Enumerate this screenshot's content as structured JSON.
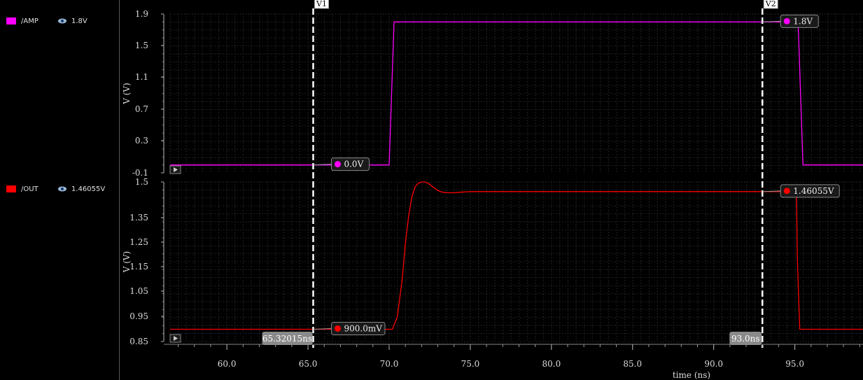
{
  "legend": {
    "traces": [
      {
        "name": "/AMP",
        "value": "1.8V",
        "color": "#ff00ff"
      },
      {
        "name": "/OUT",
        "value": "1.46055V",
        "color": "#ff0000"
      }
    ]
  },
  "chart_data": [
    {
      "type": "line",
      "name": "/AMP",
      "ylabel": "V (V)",
      "xlabel": "time (ns)",
      "yticks": [
        "1.9",
        "1.5",
        "1.1",
        "0.7",
        "0.3",
        "-0.1"
      ],
      "ylim": [
        -0.1,
        1.9
      ],
      "xlim": [
        56.5,
        99.2
      ],
      "color": "#ff00ff",
      "series": [
        {
          "name": "/AMP",
          "x": [
            56.5,
            70.0,
            70.3,
            95.2,
            95.5,
            99.2
          ],
          "y": [
            0.0,
            0.0,
            1.8,
            1.8,
            0.0,
            0.0
          ]
        }
      ],
      "markers": [
        {
          "cursor": "V1",
          "label": "0.0V"
        },
        {
          "cursor": "V2",
          "label": "1.8V"
        }
      ]
    },
    {
      "type": "line",
      "name": "/OUT",
      "ylabel": "V (V)",
      "xlabel": "time (ns)",
      "yticks": [
        "1.5",
        "1.35",
        "1.25",
        "1.15",
        "1.05",
        "0.95",
        "0.85"
      ],
      "ylim": [
        0.85,
        1.5
      ],
      "xlim": [
        56.5,
        99.2
      ],
      "color": "#ff0000",
      "series": [
        {
          "name": "/OUT",
          "x": [
            56.5,
            70.2,
            70.5,
            70.8,
            71.0,
            71.2,
            71.4,
            71.6,
            71.8,
            72.0,
            72.2,
            72.4,
            72.6,
            72.8,
            73.0,
            73.3,
            73.6,
            74.0,
            74.4,
            74.8,
            75.2,
            95.1,
            95.15,
            95.3,
            99.2
          ],
          "y": [
            0.9,
            0.9,
            0.95,
            1.1,
            1.25,
            1.36,
            1.44,
            1.48,
            1.495,
            1.5,
            1.5,
            1.495,
            1.485,
            1.475,
            1.465,
            1.458,
            1.456,
            1.456,
            1.458,
            1.46,
            1.46055,
            1.46055,
            1.2,
            0.9,
            0.9
          ]
        }
      ],
      "markers": [
        {
          "cursor": "V1",
          "label": "900.0mV"
        },
        {
          "cursor": "V2",
          "label": "1.46055V"
        }
      ]
    }
  ],
  "xaxis": {
    "ticks": [
      "60.0",
      "65.0",
      "70.0",
      "75.0",
      "80.0",
      "85.0",
      "90.0",
      "95.0"
    ],
    "tick_values": [
      60,
      65,
      70,
      75,
      80,
      85,
      90,
      95
    ],
    "label": "time (ns)"
  },
  "cursors": [
    {
      "name": "V1",
      "x": 65.32015,
      "readout": "65.32015ns"
    },
    {
      "name": "V2",
      "x": 93.0,
      "readout": "93.0ns"
    }
  ]
}
